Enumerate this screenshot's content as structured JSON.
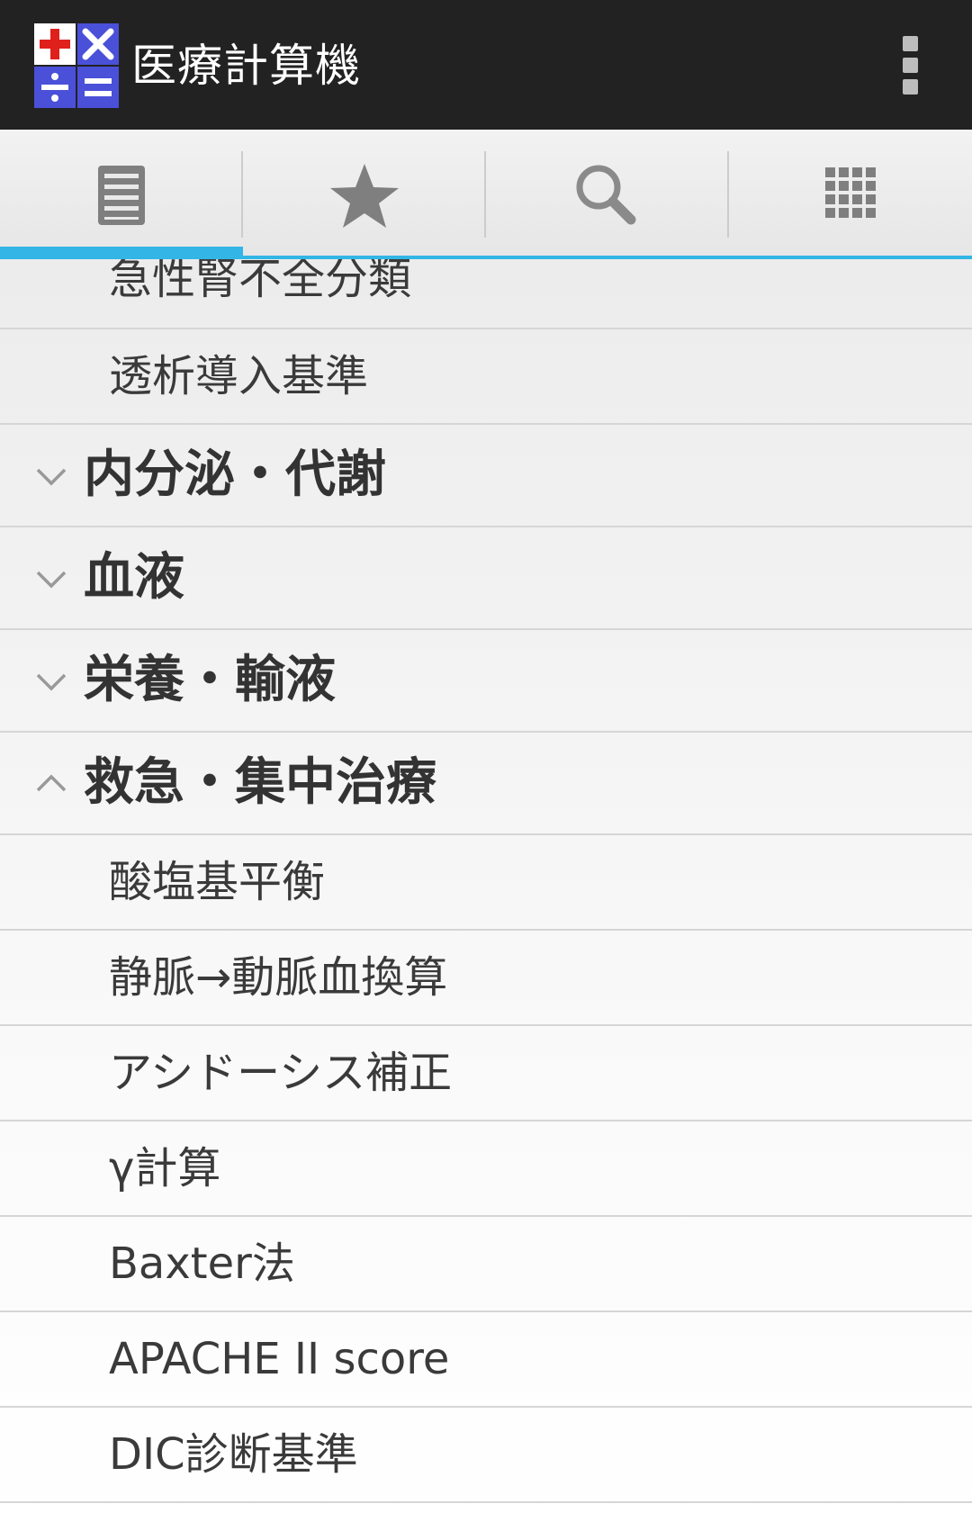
{
  "colors": {
    "actionbar_bg": "#222222",
    "accent": "#33b5e5",
    "logo_red": "#e0201a",
    "logo_blue": "#4a50d8"
  },
  "actionbar": {
    "title": "医療計算機",
    "logo_icon": "calculator-logo-icon",
    "overflow_icon": "overflow-menu-icon"
  },
  "tabs": [
    {
      "icon": "list-icon",
      "selected": true
    },
    {
      "icon": "star-icon",
      "selected": false
    },
    {
      "icon": "search-icon",
      "selected": false
    },
    {
      "icon": "grid-icon",
      "selected": false
    }
  ],
  "list": {
    "rows": [
      {
        "type": "child",
        "label": "急性腎不全分類"
      },
      {
        "type": "child",
        "label": "透析導入基準"
      },
      {
        "type": "group",
        "label": "内分泌・代謝",
        "expanded": false
      },
      {
        "type": "group",
        "label": "血液",
        "expanded": false
      },
      {
        "type": "group",
        "label": "栄養・輸液",
        "expanded": false
      },
      {
        "type": "group",
        "label": "救急・集中治療",
        "expanded": true
      },
      {
        "type": "child",
        "label": "酸塩基平衡"
      },
      {
        "type": "child",
        "label": "静脈→動脈血換算"
      },
      {
        "type": "child",
        "label": "アシドーシス補正"
      },
      {
        "type": "child",
        "label": "γ計算"
      },
      {
        "type": "child",
        "label": "Baxter法"
      },
      {
        "type": "child",
        "label": "APACHE II score"
      },
      {
        "type": "child",
        "label": "DIC診断基準"
      }
    ]
  }
}
